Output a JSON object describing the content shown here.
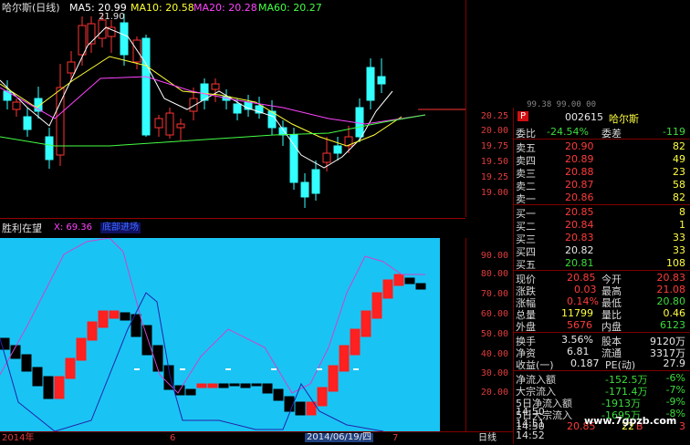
{
  "header": {
    "title": "哈尔斯(日线)",
    "ma": [
      {
        "label": "MA5: 20.99",
        "color": "#ffffff"
      },
      {
        "label": "MA10: 20.58",
        "color": "#ffff00"
      },
      {
        "label": "MA20: 20.28",
        "color": "#ff33ff"
      },
      {
        "label": "MA60: 20.27",
        "color": "#33ff33"
      }
    ],
    "high_marker": "21.90"
  },
  "main_axis": [
    "20.25",
    "20.00",
    "19.75",
    "19.50",
    "19.25",
    "19.00"
  ],
  "axis_top_partial": "99.38 99.00 00",
  "indicator": {
    "name": "胜利在望",
    "x_label": "X: 69.36",
    "highlight_label": "底部进场",
    "axis": [
      "90.00",
      "80.00",
      "70.00",
      "60.00",
      "50.00",
      "40.00",
      "30.00",
      "20.00"
    ]
  },
  "date_axis": {
    "start": "2014年",
    "mark6": "6",
    "cursor_date": "2014/06/19/四",
    "mark7": "7",
    "period": "日线"
  },
  "quote": {
    "badge": "P",
    "code": "002615",
    "name": "哈尔斯",
    "weibi_label": "委比",
    "weibi": "-24.54%",
    "weicha_label": "委差",
    "weicha": "-119",
    "asks": [
      {
        "label": "卖五",
        "price": "20.90",
        "vol": "82"
      },
      {
        "label": "卖四",
        "price": "20.89",
        "vol": "49"
      },
      {
        "label": "卖三",
        "price": "20.88",
        "vol": "23"
      },
      {
        "label": "卖二",
        "price": "20.87",
        "vol": "58"
      },
      {
        "label": "卖一",
        "price": "20.86",
        "vol": "82"
      }
    ],
    "bids": [
      {
        "label": "买一",
        "price": "20.85",
        "vol": "8"
      },
      {
        "label": "买二",
        "price": "20.84",
        "vol": "1"
      },
      {
        "label": "买三",
        "price": "20.83",
        "vol": "33"
      },
      {
        "label": "买四",
        "price": "20.82",
        "vol": "33"
      },
      {
        "label": "买五",
        "price": "20.81",
        "vol": "108"
      }
    ],
    "stats": [
      {
        "l1": "现价",
        "v1": "20.85",
        "l2": "今开",
        "v2": "20.83"
      },
      {
        "l1": "涨跌",
        "v1": "0.03",
        "l2": "最高",
        "v2": "21.08"
      },
      {
        "l1": "涨幅",
        "v1": "0.14%",
        "l2": "最低",
        "v2": "20.80"
      },
      {
        "l1": "总量",
        "v1": "11799",
        "l2": "量比",
        "v2": "0.46"
      },
      {
        "l1": "外盘",
        "v1": "5676",
        "l2": "内盘",
        "v2": "6123"
      }
    ],
    "stats2": [
      {
        "l1": "换手",
        "v1": "3.56%",
        "l2": "股本",
        "v2": "9120万"
      },
      {
        "l1": "净资",
        "v1": "6.81",
        "l2": "流通",
        "v2": "3317万"
      },
      {
        "l1": "收益(一)",
        "v1": "0.187",
        "l2": "PE(动)",
        "v2": "27.9"
      }
    ],
    "flows": [
      {
        "label": "净流入额",
        "value": "-152.5万",
        "pct": "-6%"
      },
      {
        "label": "大宗流入",
        "value": "-171.4万",
        "pct": "-7%"
      },
      {
        "label": "5日净流入额",
        "value": "-1913万",
        "pct": "-9%"
      },
      {
        "label": "5日大宗流入",
        "value": "-1695万",
        "pct": "-8%"
      }
    ],
    "ticks": [
      {
        "time": "14:50",
        "price": "20.85",
        "vol": "22",
        "side": "B"
      },
      {
        "time": "14:50",
        "price": "",
        "vol": "",
        "side": ""
      },
      {
        "time": "14:51",
        "price": "",
        "vol": "",
        "side": ""
      },
      {
        "time": "14:52",
        "price": "",
        "vol": "",
        "side": ""
      },
      {
        "time": "14:52",
        "price": "",
        "vol": "",
        "side": ""
      }
    ],
    "small_b": "3",
    "watermark": "www.7gpzb.com"
  },
  "colors": {
    "up": "#ff3333",
    "down": "#33ffff",
    "ind_bg": "#19c4f4"
  }
}
